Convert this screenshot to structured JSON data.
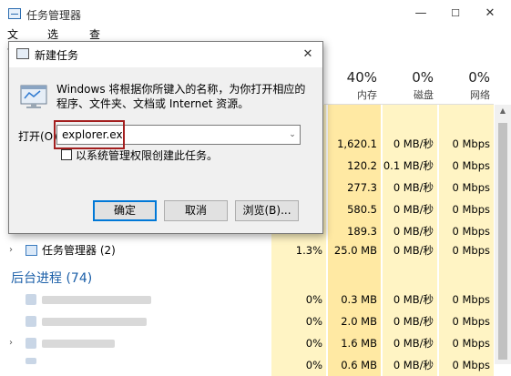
{
  "window": {
    "title": "任务管理器",
    "controls": {
      "minimize": "—",
      "maximize": "☐",
      "close": "✕"
    }
  },
  "menu": [
    {
      "label": "文件(F)"
    },
    {
      "label": "选项(O)"
    },
    {
      "label": "查看(V)"
    }
  ],
  "columns": {
    "memory": {
      "pct": "40%",
      "label": "内存"
    },
    "disk": {
      "pct": "0%",
      "label": "磁盘"
    },
    "network": {
      "pct": "0%",
      "label": "网络"
    }
  },
  "rows": [
    {
      "mem": "1,620.1 ...",
      "disk": "0 MB/秒",
      "net": "0 Mbps"
    },
    {
      "mem": "120.2 MB",
      "disk": "0.1 MB/秒",
      "net": "0 Mbps"
    },
    {
      "mem": "277.3 MB",
      "disk": "0 MB/秒",
      "net": "0 Mbps"
    },
    {
      "mem": "580.5 MB",
      "disk": "0 MB/秒",
      "net": "0 Mbps"
    },
    {
      "mem": "189.3 MB",
      "disk": "0 MB/秒",
      "net": "0 Mbps"
    }
  ],
  "task_manager_row": {
    "name": "任务管理器 (2)",
    "cpu": "1.3%",
    "mem": "25.0 MB",
    "disk": "0 MB/秒",
    "net": "0 Mbps"
  },
  "background_group": {
    "title": "后台进程 (74)"
  },
  "bg_rows": [
    {
      "cpu": "0%",
      "mem": "0.3 MB",
      "disk": "0 MB/秒",
      "net": "0 Mbps"
    },
    {
      "cpu": "0%",
      "mem": "2.0 MB",
      "disk": "0 MB/秒",
      "net": "0 Mbps"
    },
    {
      "cpu": "0%",
      "mem": "1.6 MB",
      "disk": "0 MB/秒",
      "net": "0 Mbps"
    },
    {
      "cpu": "0%",
      "mem": "0.6 MB",
      "disk": "0 MB/秒",
      "net": "0 Mbps"
    }
  ],
  "run_dialog": {
    "title": "新建任务",
    "close": "✕",
    "description": "Windows 将根据你所键入的名称，为你打开相应的程序、文件夹、文档或 Internet 资源。",
    "open_label": "打开(O):",
    "input_value": "explorer.ex",
    "dropdown": "⌄",
    "checkbox_label": "以系统管理权限创建此任务。",
    "ok": "确定",
    "cancel": "取消",
    "browse": "浏览(B)..."
  },
  "colors": {
    "cpu_cell": "#fff4c4",
    "mem_cell": "#ffe9a3",
    "highlight": "#a31f1f",
    "group_title": "#1b5fa8"
  }
}
